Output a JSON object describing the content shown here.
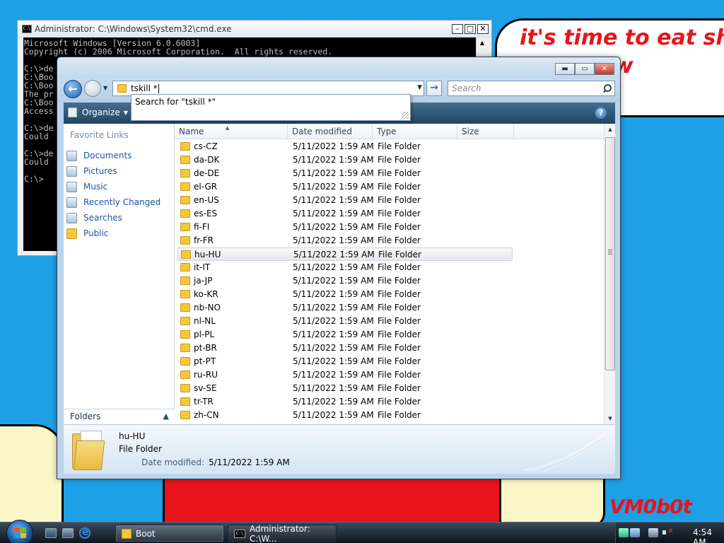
{
  "wallpaper": {
    "bubble_text": "it's time to eat shit\nand chew\num",
    "signature": "VM0b0t"
  },
  "cmd_window": {
    "title": "Administrator: C:\\Windows\\System32\\cmd.exe",
    "lines": [
      "Microsoft Windows [Version 6.0.6003]",
      "Copyright (c) 2006 Microsoft Corporation.  All rights reserved.",
      "",
      "C:\\>de",
      "C:\\Boo",
      "C:\\Boo",
      "The pr",
      "C:\\Boo",
      "Access",
      "",
      "C:\\>de",
      "Could ",
      "",
      "C:\\>de",
      "Could ",
      "",
      "C:\\>"
    ]
  },
  "explorer": {
    "address_value": "tskill *",
    "search_placeholder": "Search",
    "search_suggestion": "Search for \"tskill *\"",
    "organize_label": "Organize",
    "favorite_links_header": "Favorite Links",
    "favorite_links": [
      {
        "label": "Documents",
        "icon": "documents-icon"
      },
      {
        "label": "Pictures",
        "icon": "pictures-icon"
      },
      {
        "label": "Music",
        "icon": "music-icon"
      },
      {
        "label": "Recently Changed",
        "icon": "recently-changed-icon"
      },
      {
        "label": "Searches",
        "icon": "searches-icon"
      },
      {
        "label": "Public",
        "icon": "public-folder-icon"
      }
    ],
    "folders_label": "Folders",
    "columns": [
      "Name",
      "Date modified",
      "Type",
      "Size"
    ],
    "files": [
      {
        "name": "cs-CZ",
        "date": "5/11/2022 1:59 AM",
        "type": "File Folder"
      },
      {
        "name": "da-DK",
        "date": "5/11/2022 1:59 AM",
        "type": "File Folder"
      },
      {
        "name": "de-DE",
        "date": "5/11/2022 1:59 AM",
        "type": "File Folder"
      },
      {
        "name": "el-GR",
        "date": "5/11/2022 1:59 AM",
        "type": "File Folder"
      },
      {
        "name": "en-US",
        "date": "5/11/2022 1:59 AM",
        "type": "File Folder"
      },
      {
        "name": "es-ES",
        "date": "5/11/2022 1:59 AM",
        "type": "File Folder"
      },
      {
        "name": "fi-FI",
        "date": "5/11/2022 1:59 AM",
        "type": "File Folder"
      },
      {
        "name": "fr-FR",
        "date": "5/11/2022 1:59 AM",
        "type": "File Folder"
      },
      {
        "name": "hu-HU",
        "date": "5/11/2022 1:59 AM",
        "type": "File Folder"
      },
      {
        "name": "it-IT",
        "date": "5/11/2022 1:59 AM",
        "type": "File Folder"
      },
      {
        "name": "ja-JP",
        "date": "5/11/2022 1:59 AM",
        "type": "File Folder"
      },
      {
        "name": "ko-KR",
        "date": "5/11/2022 1:59 AM",
        "type": "File Folder"
      },
      {
        "name": "nb-NO",
        "date": "5/11/2022 1:59 AM",
        "type": "File Folder"
      },
      {
        "name": "nl-NL",
        "date": "5/11/2022 1:59 AM",
        "type": "File Folder"
      },
      {
        "name": "pl-PL",
        "date": "5/11/2022 1:59 AM",
        "type": "File Folder"
      },
      {
        "name": "pt-BR",
        "date": "5/11/2022 1:59 AM",
        "type": "File Folder"
      },
      {
        "name": "pt-PT",
        "date": "5/11/2022 1:59 AM",
        "type": "File Folder"
      },
      {
        "name": "ru-RU",
        "date": "5/11/2022 1:59 AM",
        "type": "File Folder"
      },
      {
        "name": "sv-SE",
        "date": "5/11/2022 1:59 AM",
        "type": "File Folder"
      },
      {
        "name": "tr-TR",
        "date": "5/11/2022 1:59 AM",
        "type": "File Folder"
      },
      {
        "name": "zh-CN",
        "date": "5/11/2022 1:59 AM",
        "type": "File Folder"
      }
    ],
    "selected_name": "hu-HU",
    "details": {
      "name": "hu-HU",
      "type": "File Folder",
      "date_label": "Date modified:",
      "date_value": "5/11/2022 1:59 AM"
    }
  },
  "taskbar": {
    "items": [
      {
        "label": "Boot",
        "icon": "folder-icon"
      },
      {
        "label": "Administrator: C:\\W...",
        "icon": "cmd-icon"
      }
    ],
    "clock": "4:54 AM"
  },
  "colors": {
    "desktop": "#1ea0e6",
    "wallpaper_text": "#e8141c",
    "link": "#1a54a8",
    "toolbar": "#1f4562"
  }
}
